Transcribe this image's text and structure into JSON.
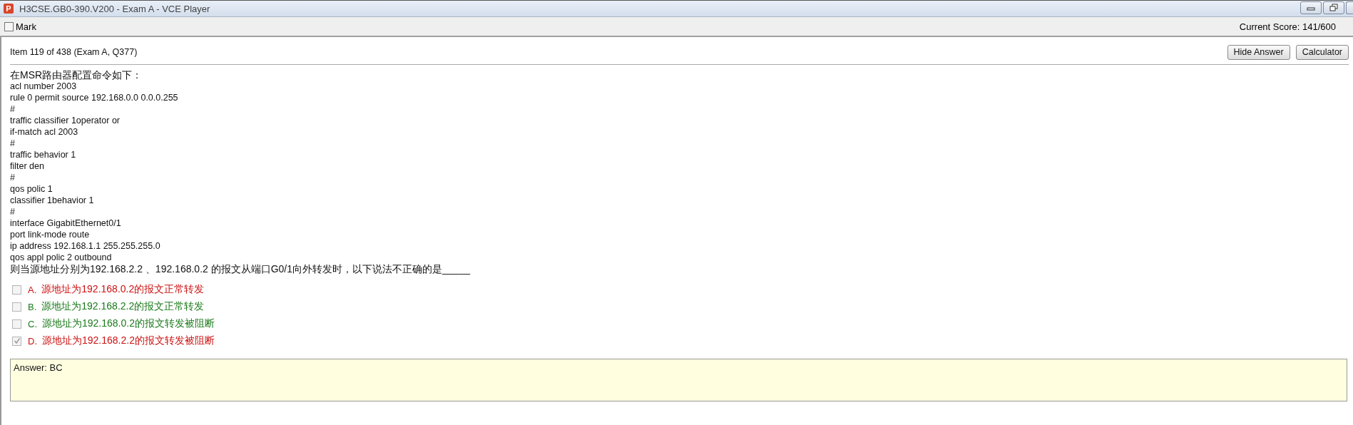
{
  "window": {
    "icon_text": "P",
    "title": "H3CSE.GB0-390.V200 - Exam A - VCE Player"
  },
  "toolbar": {
    "mark": {
      "label": "Mark",
      "checked": false
    },
    "score": "Current Score: 141/600"
  },
  "item": {
    "label": "Item 119 of 438  (Exam A, Q377)",
    "buttons": [
      "Hide Answer",
      "Calculator"
    ]
  },
  "question": {
    "intro": "在MSR路由器配置命令如下：",
    "code_lines": [
      "acl number 2003",
      "rule 0 permit source 192.168.0.0 0.0.0.255",
      "#",
      "traffic classifier 1operator or",
      "if-match acl 2003",
      "#",
      "traffic behavior 1",
      "filter den",
      "#",
      "qos polic 1",
      "classifier 1behavior 1",
      "#",
      "interface GigabitEthernet0/1",
      "port link-mode route",
      "ip address 192.168.1.1 255.255.255.0",
      "qos appl polic 2 outbound"
    ],
    "prompt": "则当源地址分别为192.168.2.2 、192.168.0.2 的报文从端口G0/1向外转发时，以下说法不正确的是_____"
  },
  "options": [
    {
      "letter": "A.",
      "text": "源地址为192.168.0.2的报文正常转发",
      "checked": false,
      "color": "#cc1111"
    },
    {
      "letter": "B.",
      "text": "源地址为192.168.2.2的报文正常转发",
      "checked": false,
      "color": "#1a7a1a"
    },
    {
      "letter": "C.",
      "text": "源地址为192.168.0.2的报文转发被阻断",
      "checked": false,
      "color": "#1a7a1a"
    },
    {
      "letter": "D.",
      "text": "源地址为192.168.2.2的报文转发被阻断",
      "checked": true,
      "color": "#cc1111"
    }
  ],
  "answer": {
    "text": "Answer: BC"
  }
}
